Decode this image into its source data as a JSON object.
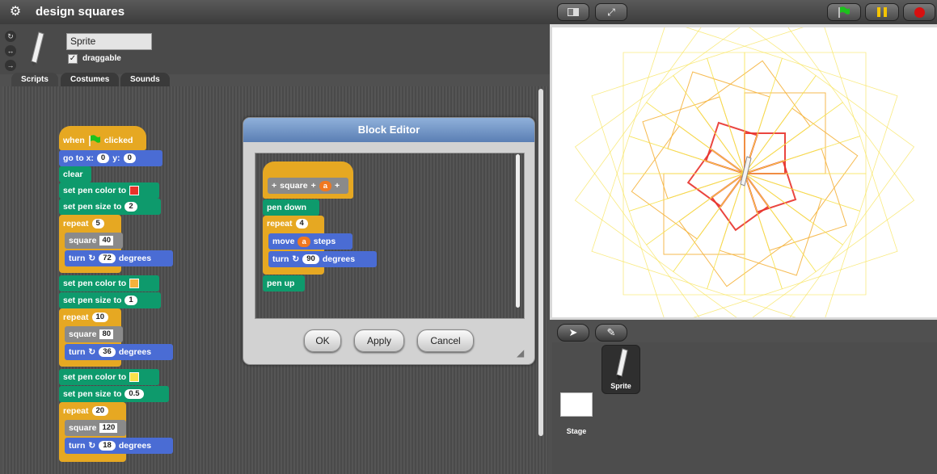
{
  "app": {
    "title": "design squares"
  },
  "topbar": {
    "logo_icon": "settings-gear-icon"
  },
  "sprite": {
    "name": "Sprite",
    "draggable_label": "draggable",
    "draggable_checked": "✓"
  },
  "tabs": [
    {
      "label": "Scripts"
    },
    {
      "label": "Costumes"
    },
    {
      "label": "Sounds"
    }
  ],
  "script": {
    "hat_when": "when",
    "hat_clicked": "clicked",
    "goto_label": "go to x:",
    "goto_x": "0",
    "goto_y_label": "y:",
    "goto_y": "0",
    "clear": "clear",
    "set_pen_color": "set pen color to",
    "set_pen_size": "set pen size to",
    "repeat": "repeat",
    "square": "square",
    "turn": "turn",
    "degrees": "degrees",
    "size1": "2",
    "rep1": "5",
    "sq1": "40",
    "turn1": "72",
    "size2": "1",
    "rep2": "10",
    "sq2": "80",
    "turn2": "36",
    "size3": "0.5",
    "rep3": "20",
    "sq3": "120",
    "turn3": "18",
    "color1": "#e8312a",
    "color2": "#f5b23c",
    "color3": "#f7e14a"
  },
  "editor": {
    "title": "Block Editor",
    "proto_plus": "+",
    "proto_name": "square",
    "proto_param": "a",
    "pen_down": "pen down",
    "repeat": "repeat",
    "repeat_count": "4",
    "move": "move",
    "move_param": "a",
    "steps": "steps",
    "turn": "turn",
    "turn_value": "90",
    "degrees": "degrees",
    "pen_up": "pen up",
    "ok": "OK",
    "apply": "Apply",
    "cancel": "Cancel"
  },
  "corral": {
    "sprite_label": "Sprite",
    "stage_label": "Stage"
  }
}
